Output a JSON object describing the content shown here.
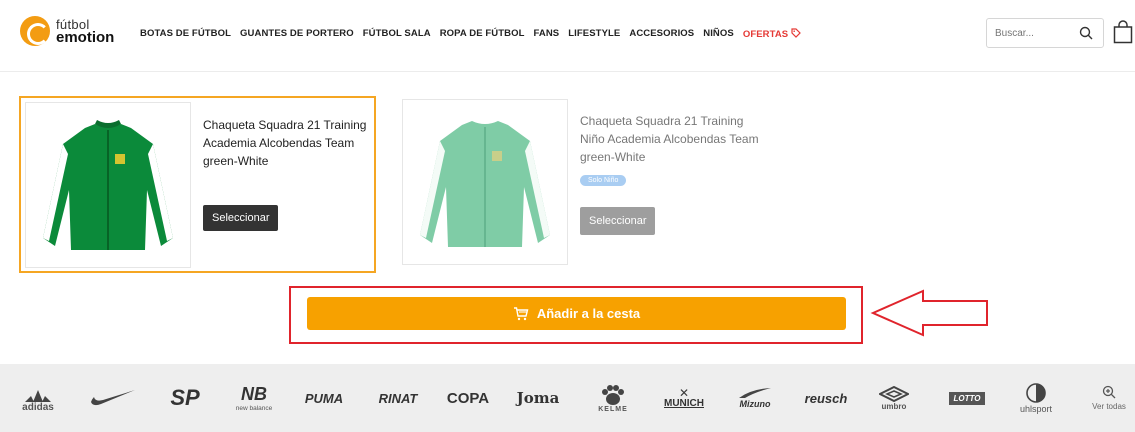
{
  "header": {
    "logo_line1": "fútbol",
    "logo_line2": "emotion",
    "nav": [
      "BOTAS DE FÚTBOL",
      "GUANTES DE PORTERO",
      "FÚTBOL SALA",
      "ROPA DE FÚTBOL",
      "FANS",
      "LIFESTYLE",
      "ACCESORIOS",
      "NIÑOS",
      "OFERTAS"
    ],
    "search_placeholder": "Buscar..."
  },
  "products": [
    {
      "name": "Chaqueta Squadra 21 Training Academia Alcobendas Team green-White",
      "button": "Seleccionar",
      "selected": true
    },
    {
      "name": "Chaqueta Squadra 21 Training Niño Academia Alcobendas Team green-White",
      "badge": "Solo Niño",
      "button": "Seleccionar",
      "selected": false
    }
  ],
  "cart": {
    "label": "Añadir a la cesta"
  },
  "brands": {
    "adidas": "adidas",
    "sp": "SP",
    "newbalance": "new balance",
    "puma": "PUMA",
    "rinat": "RINAT",
    "copa": "COPA",
    "joma": "Joma",
    "kelme": "KELME",
    "munich": "MUNICH",
    "mizuno": "Mizuno",
    "reusch": "reusch",
    "umbro": "umbro",
    "lotto": "LOTTO",
    "uhlsport": "uhlsport",
    "ver_todas": "Ver todas"
  },
  "colors": {
    "accent_orange": "#f7a100",
    "highlight_red": "#e0242c",
    "offer_red": "#e53935"
  }
}
